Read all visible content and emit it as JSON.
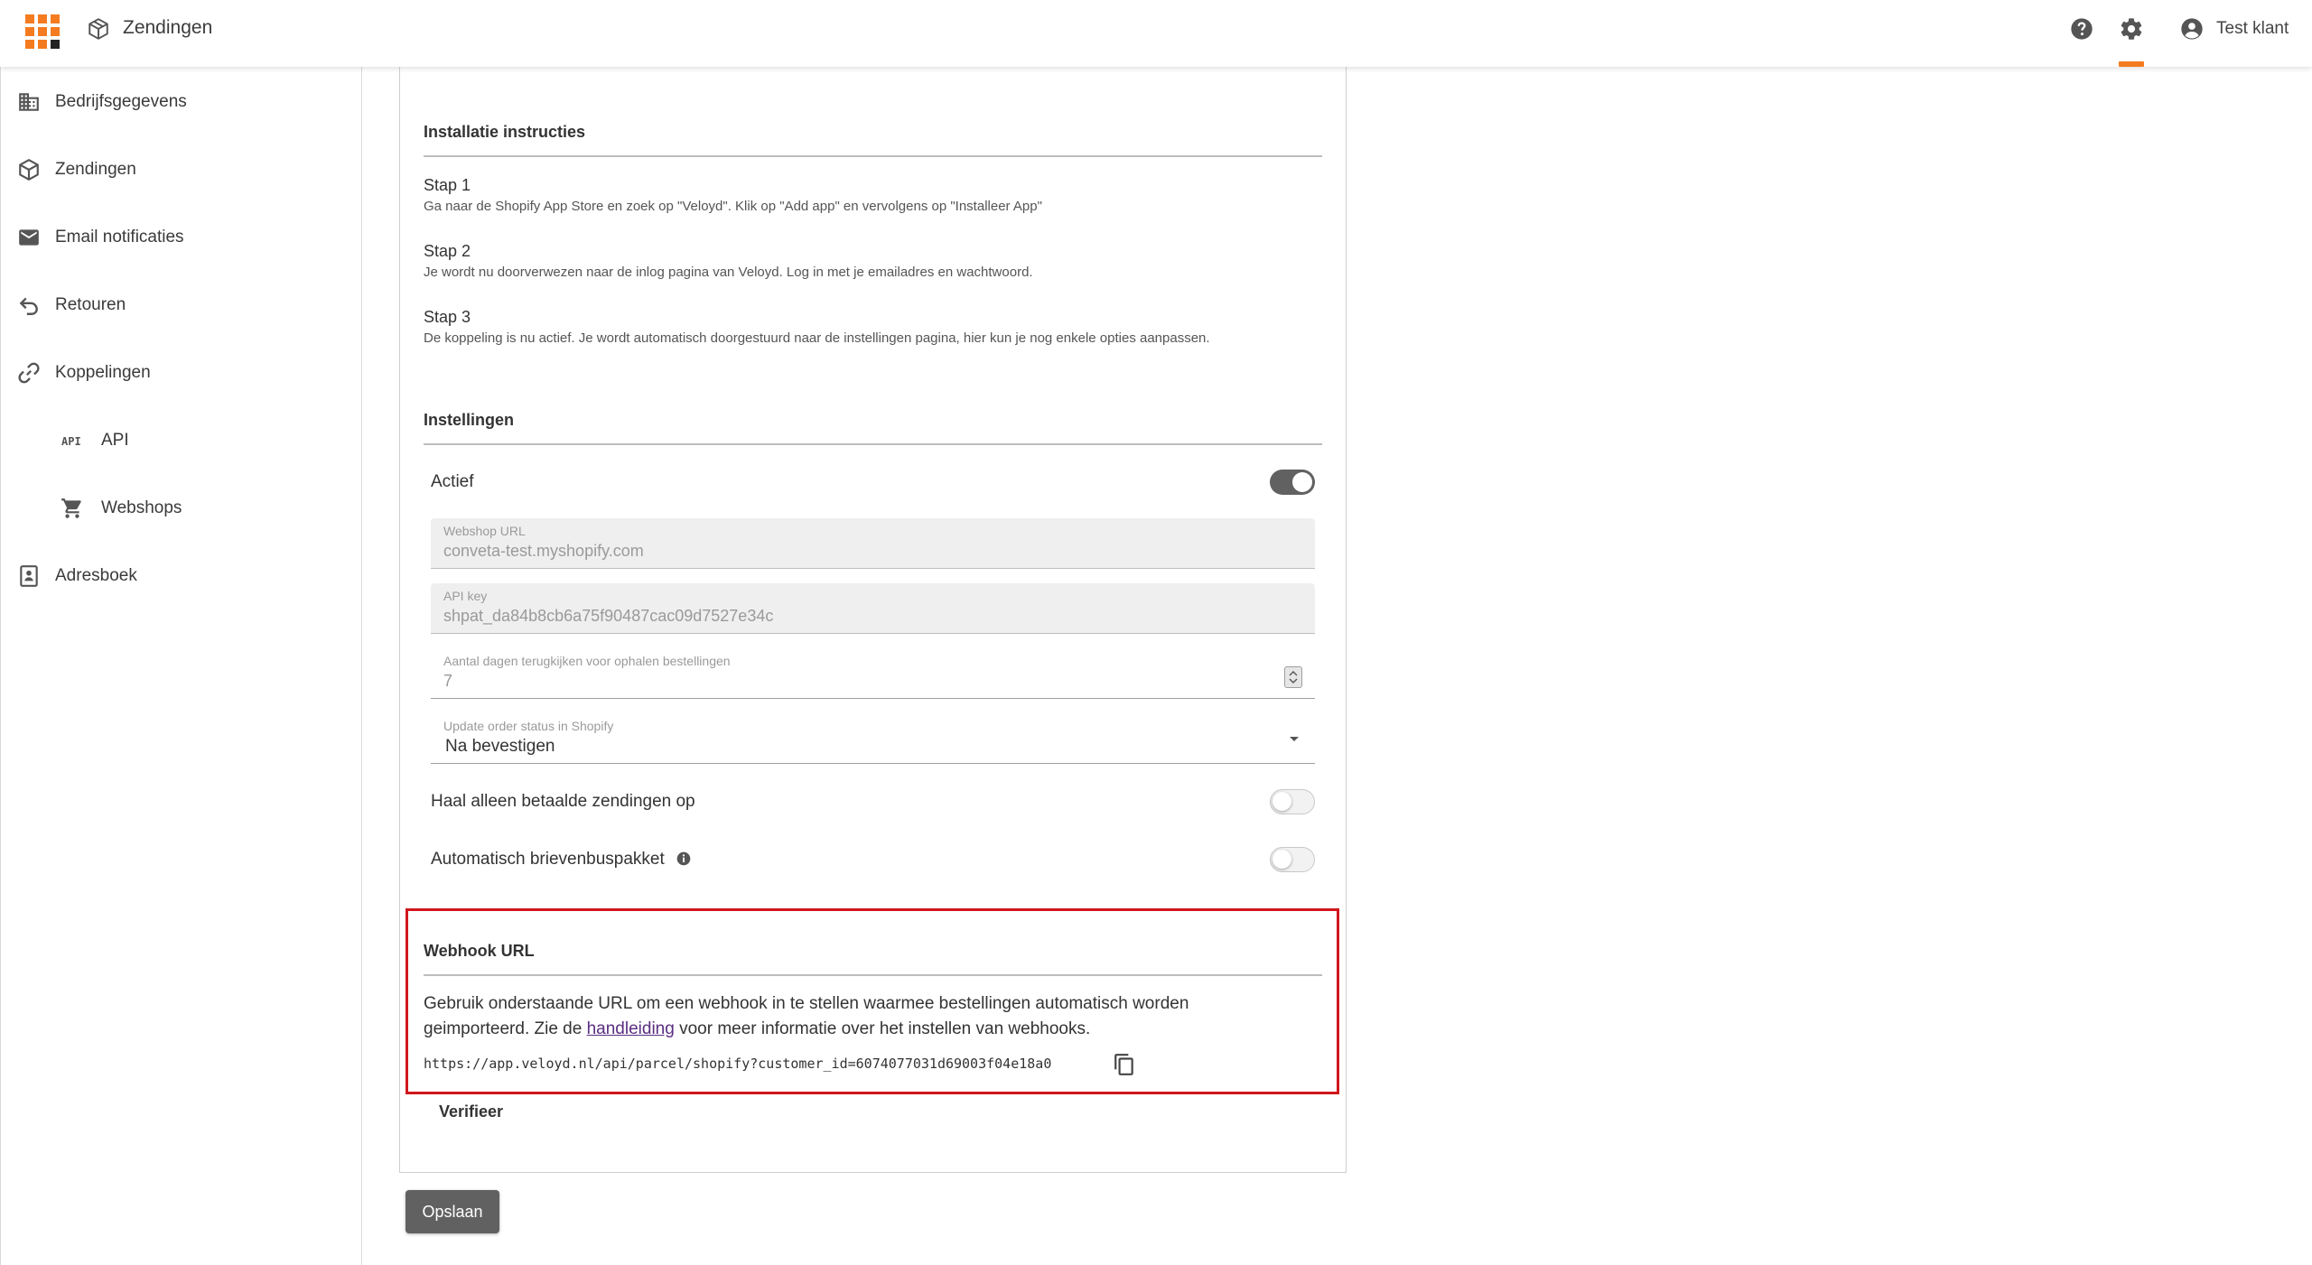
{
  "header": {
    "page_icon": "package-icon",
    "title": "Zendingen",
    "help_icon": "help-icon",
    "settings_icon": "gear-icon",
    "user_icon": "account-circle-icon",
    "user_name": "Test klant",
    "accent_color": "#f47b20"
  },
  "sidebar": {
    "items": [
      {
        "label": "Bedrijfsgegevens",
        "icon": "building-icon"
      },
      {
        "label": "Zendingen",
        "icon": "package-icon"
      },
      {
        "label": "Email notificaties",
        "icon": "mail-icon"
      },
      {
        "label": "Retouren",
        "icon": "undo-icon"
      },
      {
        "label": "Koppelingen",
        "icon": "link-icon"
      },
      {
        "label": "API",
        "icon": "api-icon"
      },
      {
        "label": "Webshops",
        "icon": "cart-icon"
      },
      {
        "label": "Adresboek",
        "icon": "contacts-icon"
      }
    ]
  },
  "install": {
    "title": "Installatie instructies",
    "steps": [
      {
        "title": "Stap 1",
        "text": "Ga naar de Shopify App Store en zoek op \"Veloyd\". Klik op \"Add app\" en vervolgens op \"Installeer App\""
      },
      {
        "title": "Stap 2",
        "text": "Je wordt nu doorverwezen naar de inlog pagina van Veloyd. Log in met je emailadres en wachtwoord."
      },
      {
        "title": "Stap 3",
        "text": "De koppeling is nu actief. Je wordt automatisch doorgestuurd naar de instellingen pagina, hier kun je nog enkele opties aanpassen."
      }
    ]
  },
  "settings": {
    "title": "Instellingen",
    "actief_label": "Actief",
    "actief_on": true,
    "webshop_url": {
      "label": "Webshop URL",
      "value": "conveta-test.myshopify.com"
    },
    "api_key": {
      "label": "API key",
      "value": "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"
    },
    "days_back": {
      "label": "Aantal dagen terugkijken voor ophalen bestellingen",
      "value": "7"
    },
    "order_status": {
      "label": "Update order status in Shopify",
      "value": "Na bevestigen"
    },
    "paid_only_label": "Haal alleen betaalde zendingen op",
    "paid_only_on": false,
    "mailbox_label": "Automatisch brievenbuspakket",
    "mailbox_info_icon": "info-icon",
    "mailbox_on": false
  },
  "webhook": {
    "title": "Webhook URL",
    "desc_before": "Gebruik onderstaande URL om een webhook in te stellen waarmee bestellingen automatisch worden geimporteerd. Zie de ",
    "link_text": "handleiding",
    "desc_after": " voor meer informatie over het instellen van webhooks.",
    "url": "https://app.veloyd.nl/api/parcel/shopify?customer_id=6074077031d69003f04e18a0",
    "copy_icon": "copy-icon",
    "highlight_color": "#d0161c"
  },
  "actions": {
    "verify_label": "Verifieer",
    "save_label": "Opslaan"
  }
}
